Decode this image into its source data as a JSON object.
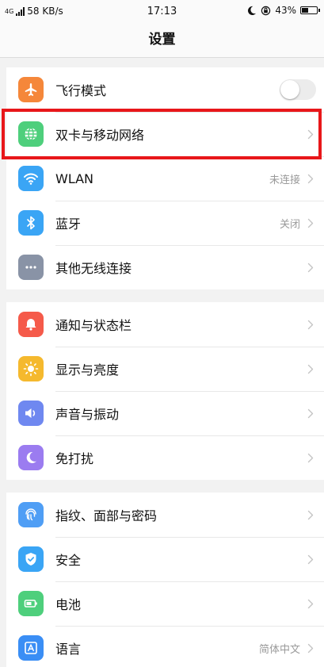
{
  "status_bar": {
    "network_label": "4G",
    "speed": "58 KB/s",
    "time": "17:13",
    "battery_percent": "43%",
    "battery_level": 0.43
  },
  "header": {
    "title": "设置"
  },
  "groups": [
    {
      "items": [
        {
          "label": "飞行模式",
          "icon": "airplane-icon",
          "color": "#f5873a",
          "toggle_on": false
        },
        {
          "label": "双卡与移动网络",
          "icon": "globe-icon",
          "color": "#4ecf7c"
        },
        {
          "label": "WLAN",
          "icon": "wifi-icon",
          "color": "#3aa5f5",
          "value": "未连接"
        },
        {
          "label": "蓝牙",
          "icon": "bluetooth-icon",
          "color": "#3aa5f5",
          "value": "关闭"
        },
        {
          "label": "其他无线连接",
          "icon": "more-dots-icon",
          "color": "#8993a6"
        }
      ]
    },
    {
      "items": [
        {
          "label": "通知与状态栏",
          "icon": "bell-icon",
          "color": "#f55a4a"
        },
        {
          "label": "显示与亮度",
          "icon": "brightness-icon",
          "color": "#f5b92e"
        },
        {
          "label": "声音与振动",
          "icon": "speaker-icon",
          "color": "#6f88f0"
        },
        {
          "label": "免打扰",
          "icon": "moon-icon",
          "color": "#9b7cf0"
        }
      ]
    },
    {
      "items": [
        {
          "label": "指纹、面部与密码",
          "icon": "fingerprint-icon",
          "color": "#4f9ef5"
        },
        {
          "label": "安全",
          "icon": "shield-icon",
          "color": "#3aa5f5"
        },
        {
          "label": "电池",
          "icon": "battery-icon",
          "color": "#4ecf7c"
        },
        {
          "label": "语言",
          "icon": "language-icon",
          "color": "#3a8ef5",
          "value": "简体中文"
        }
      ]
    }
  ],
  "highlight_color": "#e8171a"
}
